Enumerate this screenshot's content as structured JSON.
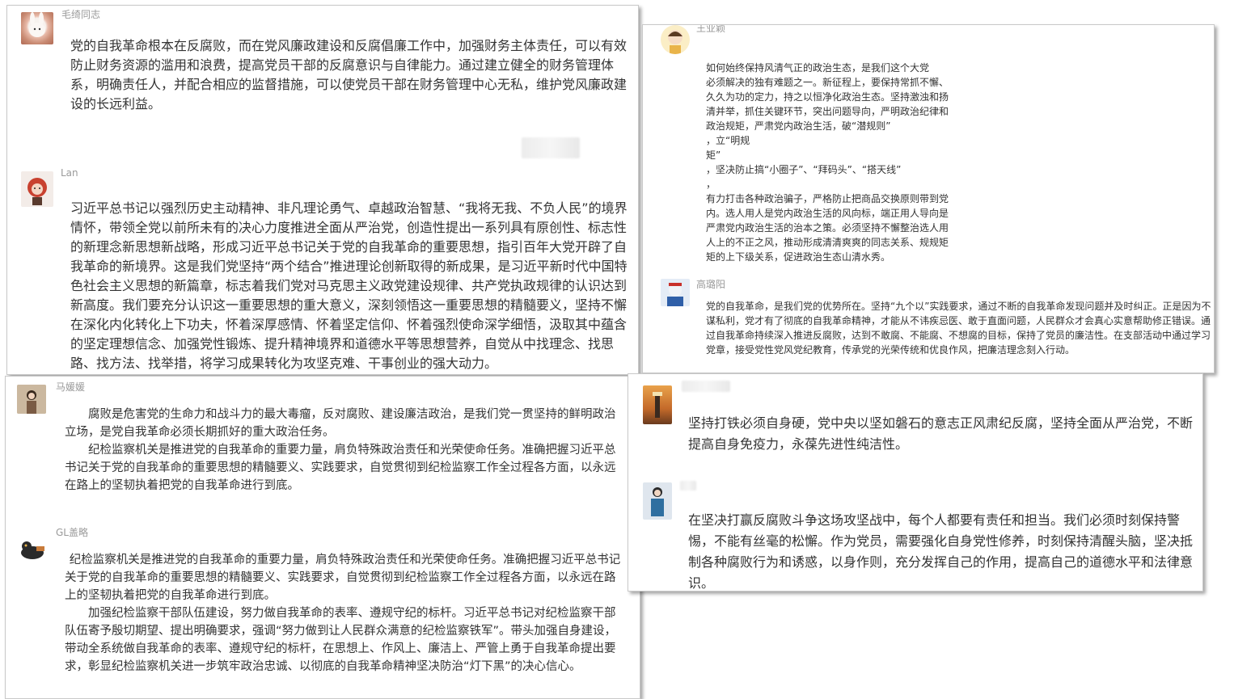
{
  "panels": {
    "p1": {
      "c1": {
        "user": "毛绮同志",
        "text": "党的自我革命根本在反腐败，而在党风廉政建设和反腐倡廉工作中，加强财务主体责任，可以有效防止财务资源的滥用和浪费，提高党员干部的反腐意识与自律能力。通过建立健全的财务管理体系，明确责任人，并配合相应的监督措施，可以使党员干部在财务管理中心无私，维护党风廉政建设的长远利益。"
      },
      "c2": {
        "user": "Lan",
        "text": "习近平总书记以强烈历史主动精神、非凡理论勇气、卓越政治智慧、“我将无我、不负人民”的境界情怀，带领全党以前所未有的决心力度推进全面从严治党，创造性提出一系列具有原创性、标志性的新理念新思想新战略，形成习近平总书记关于党的自我革命的重要思想，指引百年大党开辟了自我革命的新境界。这是我们党坚持“两个结合”推进理论创新取得的新成果，是习近平新时代中国特色社会主义思想的新篇章，标志着我们党对马克思主义政党建设规律、共产党执政规律的认识达到新高度。我们要充分认识这一重要思想的重大意义，深刻领悟这一重要思想的精髓要义，坚持不懈在深化内化转化上下功夫，怀着深厚感情、怀着坚定信仰、怀着强烈使命深学细悟，汲取其中蕴含的坚定理想信念、加强党性锻炼、提升精神境界和道德水平等思想营养，自觉从中找理念、找思路、找方法、找举措，将学习成果转化为攻坚克难、干事创业的强大动力。"
      }
    },
    "p2": {
      "c1": {
        "user": "王业颖",
        "lines": [
          "如何始终保持风清气正的政治生态，是我们这个大党",
          "必须解决的独有难题之一。新征程上，要保持常抓不懈、",
          "久久为功的定力，持之以恒净化政治生态。坚持激浊和扬",
          "清并举，抓住关键环节，突出问题导向，严明政治纪律和",
          "政治规矩，严肃党内政治生活，破“潜规则”",
          "，立“明规",
          "矩”",
          "，坚决防止搞“小圈子”、“拜码头”、“搭天线”",
          "，",
          "有力打击各种政治骗子，严格防止把商品交换原则带到党",
          "内。选人用人是党内政治生活的风向标，端正用人导向是",
          "严肃党内政治生活的治本之策。必须坚持不懈整治选人用",
          "人上的不正之风，推动形成清清爽爽的同志关系、规规矩",
          "矩的上下级关系，促进政治生态山清水秀。"
        ]
      },
      "c2": {
        "user": "高璐阳",
        "text": "党的自我革命，是我们党的优势所在。坚持“九个以”实践要求，通过不断的自我革命发现问题并及时纠正。正是因为不谋私利，党才有了彻底的自我革命精神，才能从不讳疾忌医、敢于直面问题，人民群众才会真心实意帮助修正错误。通过自我革命持续深入推进反腐败，达到不敢腐、不能腐、不想腐的目标，保持了党员的廉洁性。在支部活动中通过学习党章，接受党性党风党纪教育，传承党的光荣传统和优良作风，把廉洁理念刻入行动。"
      }
    },
    "p3": {
      "c1": {
        "user": "马媛媛",
        "paras": [
          "腐败是危害党的生命力和战斗力的最大毒瘤，反对腐败、建设廉洁政治，是我们党一贯坚持的鲜明政治立场，是党自我革命必须长期抓好的重大政治任务。",
          "纪检监察机关是推进党的自我革命的重要力量，肩负特殊政治责任和光荣使命任务。准确把握习近平总书记关于党的自我革命的重要思想的精髓要义、实践要求，自觉贯彻到纪检监察工作全过程各方面，以永远在路上的坚韧执着把党的自我革命进行到底。"
        ]
      },
      "c2": {
        "user": "GL盖略",
        "paras": [
          "纪检监察机关是推进党的自我革命的重要力量，肩负特殊政治责任和光荣使命任务。准确把握习近平总书记关于党的自我革命的重要思想的精髓要义、实践要求，自觉贯彻到纪检监察工作全过程各方面，以永远在路上的坚韧执着把党的自我革命进行到底。",
          "加强纪检监察干部队伍建设，努力做自我革命的表率、遵规守纪的标杆。习近平总书记对纪检监察干部队伍寄予殷切期望、提出明确要求，强调“努力做到让人民群众满意的纪检监察铁军”。带头加强自身建设，带动全系统做自我革命的表率、遵规守纪的标杆，在思想上、作风上、廉洁上、严管上勇于自我革命提出要求，彰显纪检监察机关进一步筑牢政治忠诚、以彻底的自我革命精神坚决防治“灯下黑”的决心信心。"
        ]
      }
    },
    "p4": {
      "c1": {
        "text": "坚持打铁必须自身硬，党中央以坚如磐石的意志正风肃纪反腐，坚持全面从严治党，不断提高自身免疫力，永葆先进性纯洁性。"
      },
      "c2": {
        "text": "在坚决打赢反腐败斗争这场攻坚战中，每个人都要有责任和担当。我们必须时刻保持警惕，不能有丝毫的松懈。作为党员，需要强化自身党性修养，时刻保持清醒头脑，坚决抵制各种腐败行为和诱惑，以身作则，充分发挥自己的作用，提高自己的道德水平和法律意识。"
      }
    }
  }
}
